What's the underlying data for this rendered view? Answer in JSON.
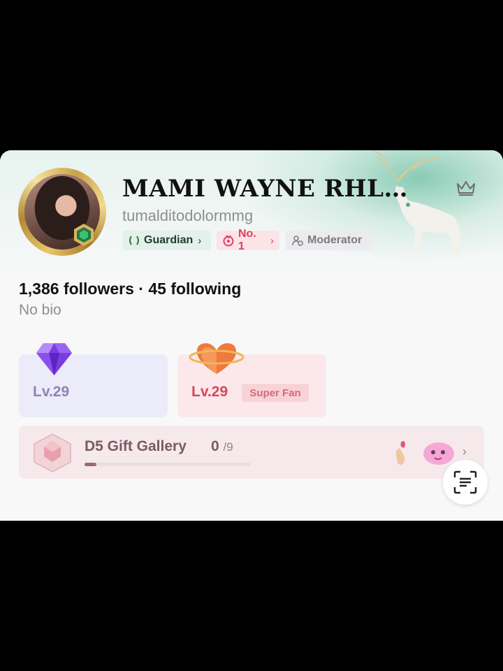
{
  "profile": {
    "display_name": "MAMI WAYNE RHL…",
    "handle": "tumalditodolormmg"
  },
  "badges": {
    "guardian": {
      "label": "Guardian",
      "icon": "laurel-icon",
      "color": "#1f3c2c"
    },
    "rank": {
      "label": "No. 1",
      "icon": "medal-icon",
      "color": "#e0405e"
    },
    "moderator": {
      "label": "Moderator",
      "icon": "moderator-icon",
      "color": "#7a7a80"
    }
  },
  "stats": {
    "text": "1,386 followers · 45 following",
    "followers": 1386,
    "following": 45
  },
  "bio": "No bio",
  "levels": {
    "gifter": {
      "label": "Lv.29",
      "icon": "diamond-icon",
      "color": "#8c84b3"
    },
    "fan": {
      "label": "Lv.29",
      "tag": "Super Fan",
      "icon": "heart-ring-icon",
      "color": "#d4495a"
    }
  },
  "gallery": {
    "title": "D5 Gift Gallery",
    "collected": "0",
    "total": "/9",
    "progress_fraction": 0.07
  },
  "actions": {
    "crown": "crown-icon",
    "scan": "scan-text-icon"
  }
}
